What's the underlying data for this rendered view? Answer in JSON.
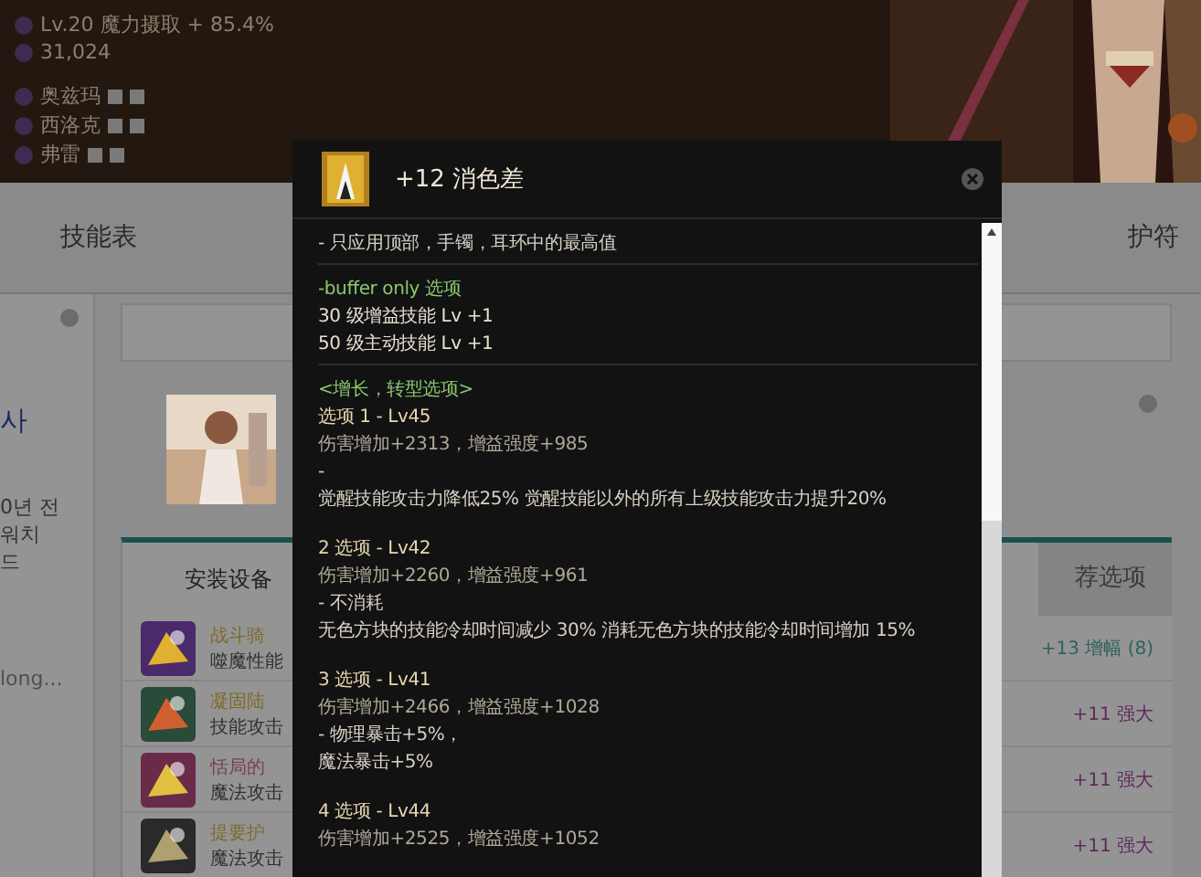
{
  "profile": {
    "power": "Lv.20 魔力摄取 + 85.4%",
    "score": "31,024",
    "raids": [
      {
        "name": "奥兹玛"
      },
      {
        "name": "西洛克"
      },
      {
        "name": "弗雷"
      }
    ]
  },
  "tabs": [
    {
      "label": "技能表"
    },
    {
      "label": "护符"
    }
  ],
  "side": {
    "name": "사",
    "lines": [
      "0년 전",
      "워치",
      "드"
    ],
    "more": "long..."
  },
  "equipment": {
    "tab": "安装设备",
    "side_tab": "荐选项",
    "rows": [
      {
        "name": "战斗骑",
        "sub": "噬魔性能",
        "color": "#7e6b2b",
        "bonus": {
          "text": "+13 增幅 (8)",
          "color": "#2b615d"
        }
      },
      {
        "name": "凝固陆",
        "sub": "技能攻击",
        "color": "#7e6b2b",
        "bonus": {
          "text": "+11 强大",
          "color": "#5d2b5b"
        }
      },
      {
        "name": "恬局的",
        "sub": "魔法攻击",
        "color": "#7b3e59",
        "bonus": {
          "text": "+11 强大",
          "color": "#5d2b5b"
        }
      },
      {
        "name": "提要护",
        "sub": "魔法攻击",
        "color": "#7e6b2b",
        "bonus": {
          "text": "+11 强大",
          "color": "#5d2b5b"
        }
      }
    ]
  },
  "tooltip": {
    "title": "+12 消色差",
    "notes": [
      "- 只应用顶部，手镯，耳环中的最高值"
    ],
    "buffer": {
      "heading": "-buffer only 选项",
      "lines": [
        "30 级增益技能 Lv +1",
        "50 级主动技能 Lv +1"
      ]
    },
    "growth": {
      "heading": "<增长，转型选项>",
      "options": [
        {
          "title": "选项 1 - Lv45",
          "stat": "伤害增加+2313，增益强度+985",
          "effects": [
            "-",
            "觉醒技能攻击力降低25% 觉醒技能以外的所有上级技能攻击力提升20%"
          ]
        },
        {
          "title": "2 选项 - Lv42",
          "stat": "伤害增加+2260，增益强度+961",
          "effects": [
            "- 不消耗",
            "无色方块的技能冷却时间减少 30% 消耗无色方块的技能冷却时间增加 15%"
          ]
        },
        {
          "title": "3 选项 - Lv41",
          "stat": "伤害增加+2466，增益强度+1028",
          "effects": [
            "- 物理暴击+5%，",
            "魔法暴击+5%"
          ]
        },
        {
          "title": "4 选项 - Lv44",
          "stat": "伤害增加+2525，增益强度+1052"
        }
      ]
    }
  }
}
